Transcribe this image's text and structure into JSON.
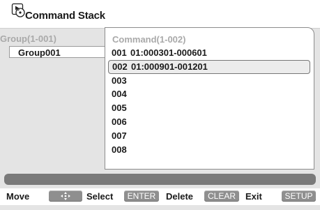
{
  "title": {
    "text": "Command Stack",
    "icon": "disc-stack-icon"
  },
  "group_panel": {
    "header": "Group(1-001)",
    "items": [
      {
        "label": "Group001",
        "selected": true
      }
    ]
  },
  "command_panel": {
    "header": "Command(1-002)",
    "rows": [
      {
        "num": "001",
        "value": "01:000301-000601",
        "selected": false
      },
      {
        "num": "002",
        "value": "01:000901-001201",
        "selected": true
      },
      {
        "num": "003",
        "value": "",
        "selected": false
      },
      {
        "num": "004",
        "value": "",
        "selected": false
      },
      {
        "num": "005",
        "value": "",
        "selected": false
      },
      {
        "num": "006",
        "value": "",
        "selected": false
      },
      {
        "num": "007",
        "value": "",
        "selected": false
      },
      {
        "num": "008",
        "value": "",
        "selected": false
      }
    ]
  },
  "footer": {
    "move_label": "Move",
    "move_key_icon": "four-way-arrows-icon",
    "select_label": "Select",
    "select_key": "ENTER",
    "delete_label": "Delete",
    "delete_key": "CLEAR",
    "exit_label": "Exit",
    "exit_key": "SETUP"
  },
  "colors": {
    "background": "#e4e4e4",
    "panel": "#ffffff",
    "header_text": "#a9a9a9",
    "key_button": "#8f8f8f",
    "progress_bar": "#7a7a7a"
  }
}
